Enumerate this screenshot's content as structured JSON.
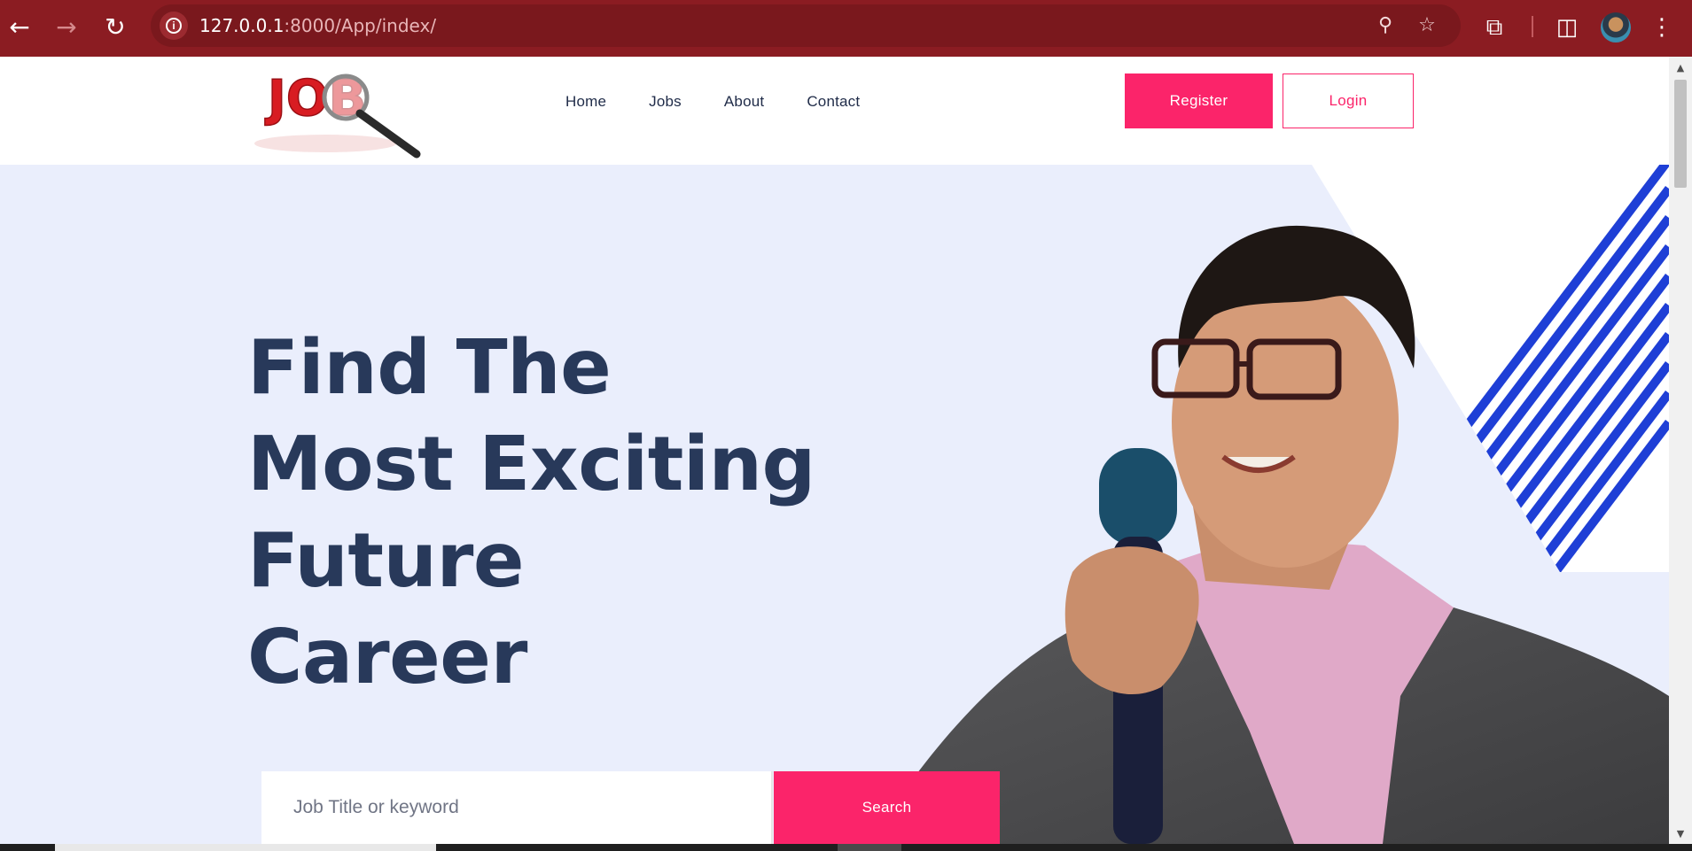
{
  "browser": {
    "url_host": "127.0.0.1",
    "url_rest": ":8000/App/index/",
    "icons": {
      "back": "arrow-left-icon",
      "forward": "arrow-right-icon",
      "reload": "reload-icon",
      "site_info": "info-icon",
      "zoom": "zoom-icon",
      "bookmark": "star-icon",
      "extensions": "puzzle-icon",
      "side_panel": "side-panel-icon",
      "menu": "kebab-menu-icon"
    },
    "colors": {
      "toolbar": "#8b1c22",
      "omnibox": "#7a181d"
    }
  },
  "site": {
    "logo_text": "JOB",
    "nav": [
      {
        "label": "Home"
      },
      {
        "label": "Jobs"
      },
      {
        "label": "About"
      },
      {
        "label": "Contact"
      }
    ],
    "register_label": "Register",
    "login_label": "Login",
    "colors": {
      "accent": "#fb246a",
      "heading": "#28395a",
      "hero_bg": "#eaeefc"
    }
  },
  "hero": {
    "title_lines": [
      "Find The",
      "Most Exciting",
      "Future",
      "Career"
    ],
    "search": {
      "placeholder": "Job Title or keyword",
      "value": "",
      "button_label": "Search"
    }
  }
}
